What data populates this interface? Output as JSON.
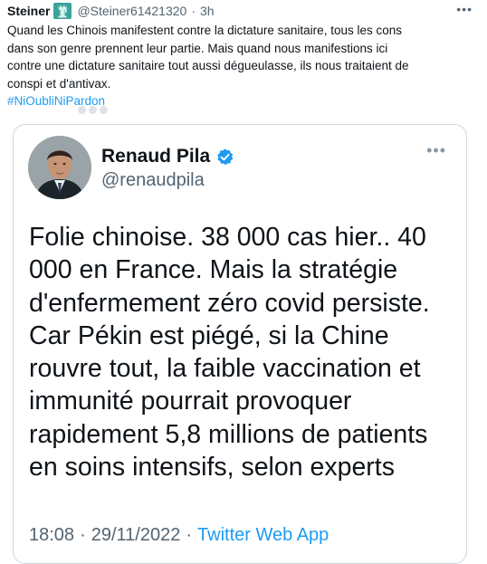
{
  "tweet": {
    "author_name": "Steiner",
    "author_emoji": "statue-of-liberty-emoji",
    "author_handle": "@Steiner61421320",
    "separator": "·",
    "time": "3h",
    "more": "•••",
    "text_lines": [
      "Quand les Chinois manifestent contre la dictature sanitaire, tous les cons",
      "dans son genre prennent leur partie. Mais quand nous manifestions ici",
      "contre une dictature sanitaire tout aussi dégueulasse, ils nous traitaient de",
      "conspi et d'antivax."
    ],
    "hashtag": "#NiOubliNiPardon"
  },
  "quoted_tweet": {
    "author_name": "Renaud Pila",
    "author_handle": "@renaudpila",
    "verified": true,
    "more": "•••",
    "text_lines": [
      "Folie chinoise. 38 000 cas hier.. 40",
      "000 en France. Mais la stratégie",
      "d'enfermement zéro covid persiste.",
      "Car Pékin est piégé, si la Chine",
      "rouvre tout, la faible vaccination et",
      "immunité pourrait provoquer",
      "rapidement 5,8 millions de patients",
      "en soins intensifs, selon experts"
    ],
    "time": "18:08",
    "separator": "·",
    "date": "29/11/2022",
    "source": "Twitter Web App"
  },
  "colors": {
    "text": "#0f1419",
    "secondary": "#536471",
    "link": "#1d9bf0",
    "border": "#cfd9de"
  }
}
